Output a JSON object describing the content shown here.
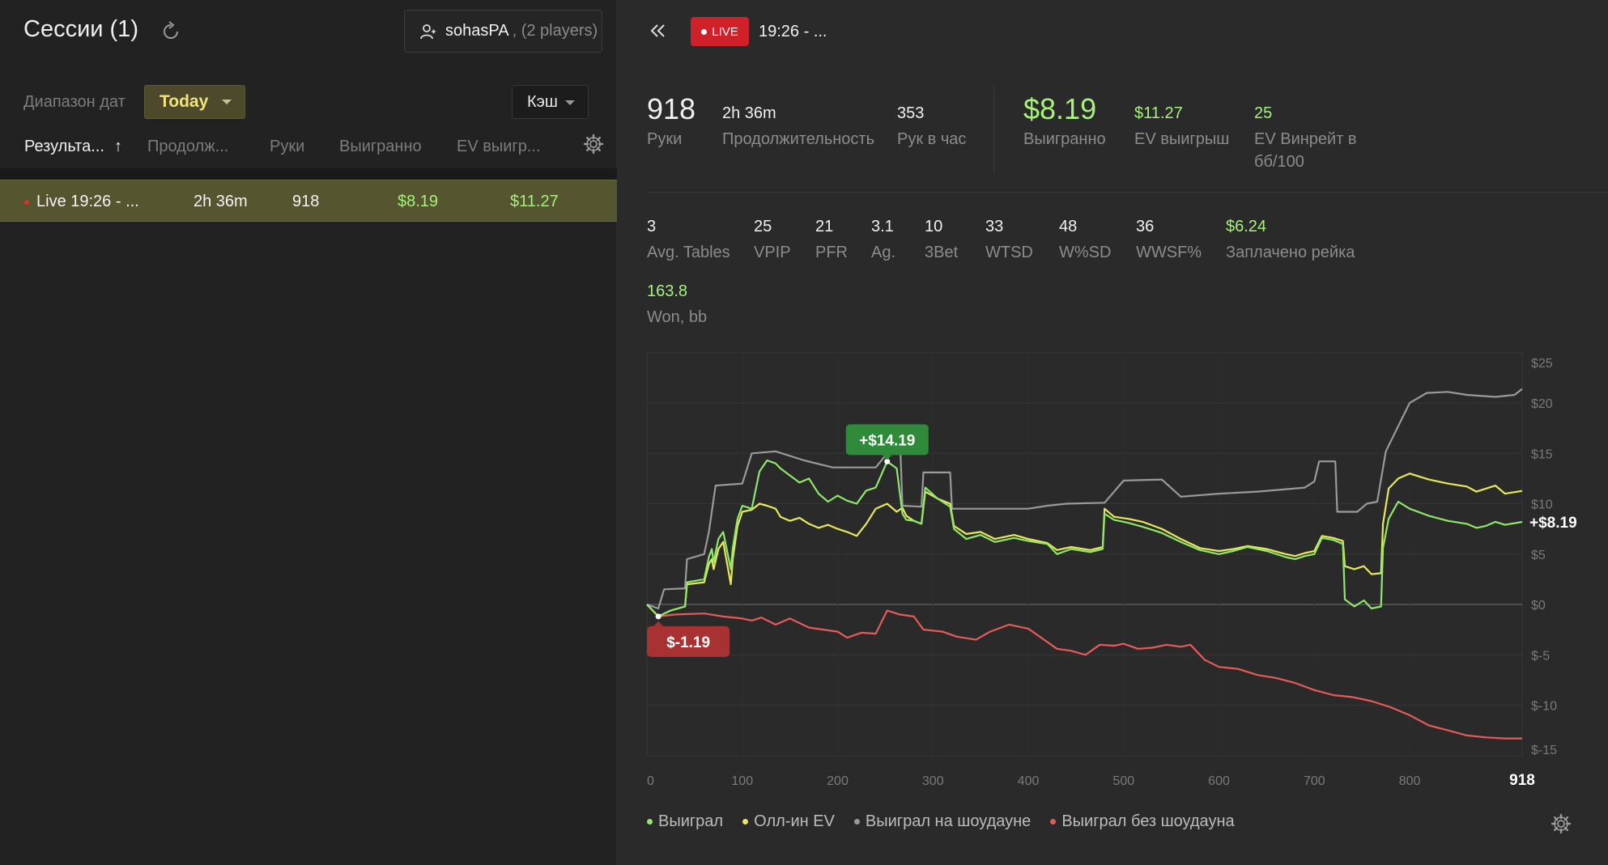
{
  "left": {
    "title": "Сессии (1)",
    "player": {
      "name": "sohasPA",
      "count": ", (2 players)"
    },
    "date_range_label": "Диапазон дат",
    "today_label": "Today",
    "cash_label": "Кэш",
    "columns": {
      "result": "Результа...",
      "sort_arrow": "↑",
      "duration": "Продолж...",
      "hands": "Руки",
      "won": "Выигранно",
      "ev": "EV выигр..."
    },
    "session_row": {
      "name": "Live 19:26 - ...",
      "duration": "2h 36m",
      "hands": "918",
      "won": "$8.19",
      "ev": "$11.27"
    }
  },
  "right": {
    "live_label": "LIVE",
    "session_time": "19:26 - ...",
    "stats_top": [
      {
        "value": "918",
        "label": "Руки"
      },
      {
        "value": "2h 36m",
        "label": "Продолжительность"
      },
      {
        "value": "353",
        "label": "Рук в час"
      },
      {
        "value": "$8.19",
        "label": "Выигранно"
      },
      {
        "value": "$11.27",
        "label": "EV выигрыш"
      },
      {
        "value": "25",
        "label": "EV Винрейт в",
        "label2": "бб/100"
      }
    ],
    "stats_mid": [
      {
        "value": "3",
        "label": "Avg. Tables"
      },
      {
        "value": "25",
        "label": "VPIP"
      },
      {
        "value": "21",
        "label": "PFR"
      },
      {
        "value": "3.1",
        "label": "Ag."
      },
      {
        "value": "10",
        "label": "3Bet"
      },
      {
        "value": "33",
        "label": "WTSD"
      },
      {
        "value": "48",
        "label": "W%SD"
      },
      {
        "value": "36",
        "label": "WWSF%"
      },
      {
        "value": "$6.24",
        "label": "Заплачено рейка"
      }
    ],
    "stats_bottom": {
      "value": "163.8",
      "label": "Won, bb"
    },
    "legend": [
      {
        "label": "Выиграл",
        "color": "#8ee86a"
      },
      {
        "label": "Олл-ин EV",
        "color": "#e8e85a"
      },
      {
        "label": "Выиграл на шоудауне",
        "color": "#9a9a9a"
      },
      {
        "label": "Выиграл без шоудауна",
        "color": "#e85a5a"
      }
    ]
  },
  "chart_data": {
    "type": "line",
    "x_ticks": [
      0,
      100,
      200,
      300,
      400,
      500,
      600,
      700,
      800
    ],
    "x_end_label": "918",
    "y_tick_labels": [
      "$25",
      "$20",
      "$15",
      "$10",
      "$5",
      "$0",
      "$-5",
      "$-10",
      "$-15"
    ],
    "y_ticks": [
      25,
      20,
      15,
      10,
      5,
      0,
      -5,
      -10,
      -15
    ],
    "xlim": [
      0,
      918
    ],
    "ylim": [
      -15,
      25
    ],
    "grid": true,
    "end_label": "+$8.19",
    "max_callout": {
      "label": "+$14.19",
      "x": 252,
      "y": 14.19
    },
    "min_callout": {
      "label": "$-1.19",
      "x": 12,
      "y": -1.19
    },
    "series": [
      {
        "name": "Выиграл",
        "color": "#8ee86a",
        "points": [
          [
            0,
            0
          ],
          [
            12,
            -1.19
          ],
          [
            25,
            -0.6
          ],
          [
            40,
            -0.2
          ],
          [
            42,
            2.2
          ],
          [
            60,
            2.5
          ],
          [
            65,
            4.7
          ],
          [
            68,
            5.5
          ],
          [
            70,
            4.2
          ],
          [
            75,
            6.5
          ],
          [
            80,
            7.2
          ],
          [
            88,
            3.5
          ],
          [
            90,
            5.6
          ],
          [
            95,
            8.5
          ],
          [
            100,
            9.8
          ],
          [
            110,
            9.5
          ],
          [
            118,
            13.2
          ],
          [
            126,
            14.3
          ],
          [
            135,
            14.0
          ],
          [
            140,
            13.5
          ],
          [
            150,
            12.8
          ],
          [
            160,
            12.1
          ],
          [
            170,
            12.5
          ],
          [
            180,
            11.0
          ],
          [
            190,
            10.2
          ],
          [
            200,
            10.8
          ],
          [
            210,
            10.3
          ],
          [
            220,
            10.0
          ],
          [
            230,
            11.3
          ],
          [
            240,
            11.6
          ],
          [
            252,
            14.19
          ],
          [
            262,
            13.5
          ],
          [
            268,
            9.0
          ],
          [
            272,
            8.4
          ],
          [
            280,
            8.3
          ],
          [
            288,
            8.0
          ],
          [
            292,
            11.6
          ],
          [
            305,
            10.5
          ],
          [
            318,
            9.7
          ],
          [
            322,
            7.5
          ],
          [
            335,
            6.5
          ],
          [
            350,
            6.9
          ],
          [
            365,
            6.2
          ],
          [
            385,
            6.6
          ],
          [
            400,
            6.3
          ],
          [
            420,
            6.0
          ],
          [
            430,
            5.0
          ],
          [
            445,
            5.5
          ],
          [
            465,
            5.2
          ],
          [
            478,
            5.5
          ],
          [
            480,
            9.0
          ],
          [
            490,
            8.4
          ],
          [
            505,
            8.1
          ],
          [
            520,
            7.7
          ],
          [
            540,
            7.1
          ],
          [
            560,
            6.2
          ],
          [
            580,
            5.4
          ],
          [
            600,
            5.0
          ],
          [
            615,
            5.3
          ],
          [
            630,
            5.7
          ],
          [
            650,
            5.3
          ],
          [
            670,
            4.7
          ],
          [
            680,
            4.5
          ],
          [
            690,
            4.8
          ],
          [
            700,
            5.0
          ],
          [
            708,
            6.6
          ],
          [
            720,
            6.4
          ],
          [
            730,
            6.0
          ],
          [
            732,
            0.5
          ],
          [
            742,
            -0.2
          ],
          [
            752,
            0.4
          ],
          [
            760,
            -0.4
          ],
          [
            770,
            -0.2
          ],
          [
            772,
            5.6
          ],
          [
            778,
            8.5
          ],
          [
            788,
            10.2
          ],
          [
            800,
            9.5
          ],
          [
            820,
            8.8
          ],
          [
            840,
            8.3
          ],
          [
            860,
            8.0
          ],
          [
            870,
            7.6
          ],
          [
            880,
            7.8
          ],
          [
            890,
            8.2
          ],
          [
            900,
            7.9
          ],
          [
            918,
            8.19
          ]
        ]
      },
      {
        "name": "Олл-ин EV",
        "color": "#e8e85a",
        "points": [
          [
            0,
            0
          ],
          [
            12,
            -1.19
          ],
          [
            25,
            -0.6
          ],
          [
            40,
            -0.2
          ],
          [
            42,
            2.0
          ],
          [
            60,
            2.2
          ],
          [
            65,
            4.0
          ],
          [
            68,
            4.5
          ],
          [
            70,
            3.5
          ],
          [
            75,
            5.5
          ],
          [
            80,
            6.2
          ],
          [
            88,
            2.0
          ],
          [
            90,
            4.5
          ],
          [
            95,
            7.8
          ],
          [
            100,
            9.2
          ],
          [
            110,
            9.4
          ],
          [
            118,
            10.0
          ],
          [
            126,
            9.8
          ],
          [
            135,
            9.5
          ],
          [
            140,
            8.7
          ],
          [
            150,
            8.3
          ],
          [
            160,
            8.6
          ],
          [
            170,
            8.0
          ],
          [
            180,
            7.6
          ],
          [
            190,
            7.9
          ],
          [
            200,
            7.5
          ],
          [
            210,
            7.2
          ],
          [
            220,
            6.8
          ],
          [
            230,
            8.0
          ],
          [
            240,
            9.5
          ],
          [
            252,
            10.0
          ],
          [
            262,
            9.2
          ],
          [
            268,
            9.6
          ],
          [
            272,
            8.8
          ],
          [
            280,
            8.3
          ],
          [
            288,
            8.0
          ],
          [
            292,
            11.2
          ],
          [
            305,
            10.5
          ],
          [
            318,
            10.0
          ],
          [
            322,
            7.8
          ],
          [
            335,
            7.0
          ],
          [
            350,
            7.2
          ],
          [
            365,
            6.5
          ],
          [
            385,
            6.9
          ],
          [
            400,
            6.5
          ],
          [
            420,
            6.1
          ],
          [
            430,
            5.4
          ],
          [
            445,
            5.7
          ],
          [
            465,
            5.4
          ],
          [
            478,
            5.7
          ],
          [
            480,
            9.5
          ],
          [
            490,
            8.7
          ],
          [
            505,
            8.5
          ],
          [
            520,
            8.2
          ],
          [
            540,
            7.5
          ],
          [
            560,
            6.5
          ],
          [
            580,
            5.6
          ],
          [
            600,
            5.3
          ],
          [
            615,
            5.5
          ],
          [
            630,
            5.8
          ],
          [
            650,
            5.5
          ],
          [
            670,
            5.0
          ],
          [
            680,
            4.8
          ],
          [
            690,
            5.1
          ],
          [
            700,
            5.3
          ],
          [
            708,
            6.8
          ],
          [
            720,
            6.6
          ],
          [
            730,
            6.3
          ],
          [
            732,
            3.8
          ],
          [
            742,
            3.5
          ],
          [
            752,
            3.8
          ],
          [
            760,
            3.0
          ],
          [
            770,
            3.1
          ],
          [
            772,
            8.0
          ],
          [
            778,
            11.5
          ],
          [
            788,
            12.5
          ],
          [
            800,
            13.0
          ],
          [
            820,
            12.4
          ],
          [
            840,
            12.0
          ],
          [
            860,
            11.7
          ],
          [
            870,
            11.2
          ],
          [
            880,
            11.5
          ],
          [
            890,
            11.8
          ],
          [
            900,
            11.0
          ],
          [
            918,
            11.27
          ]
        ]
      },
      {
        "name": "Выиграл на шоудауне",
        "color": "#9a9a9a",
        "points": [
          [
            0,
            0
          ],
          [
            12,
            -0.4
          ],
          [
            18,
            1.5
          ],
          [
            40,
            1.6
          ],
          [
            42,
            4.5
          ],
          [
            60,
            5.0
          ],
          [
            65,
            7.2
          ],
          [
            72,
            11.8
          ],
          [
            100,
            12.0
          ],
          [
            110,
            15.0
          ],
          [
            135,
            15.2
          ],
          [
            165,
            14.3
          ],
          [
            195,
            13.6
          ],
          [
            240,
            13.6
          ],
          [
            252,
            15.0
          ],
          [
            266,
            15.0
          ],
          [
            268,
            9.8
          ],
          [
            288,
            9.7
          ],
          [
            290,
            13.1
          ],
          [
            318,
            13.1
          ],
          [
            320,
            9.5
          ],
          [
            400,
            9.5
          ],
          [
            420,
            9.8
          ],
          [
            440,
            10.0
          ],
          [
            480,
            10.1
          ],
          [
            500,
            12.3
          ],
          [
            540,
            12.4
          ],
          [
            560,
            10.7
          ],
          [
            600,
            11.0
          ],
          [
            640,
            11.2
          ],
          [
            690,
            11.6
          ],
          [
            700,
            12.2
          ],
          [
            705,
            14.2
          ],
          [
            722,
            14.2
          ],
          [
            724,
            9.2
          ],
          [
            745,
            9.2
          ],
          [
            755,
            10.0
          ],
          [
            766,
            10.2
          ],
          [
            775,
            15.2
          ],
          [
            800,
            20.0
          ],
          [
            818,
            21.0
          ],
          [
            840,
            21.1
          ],
          [
            860,
            20.8
          ],
          [
            890,
            20.6
          ],
          [
            910,
            20.8
          ],
          [
            918,
            21.4
          ]
        ]
      },
      {
        "name": "Выиграл без шоудауна",
        "color": "#e85a5a",
        "points": [
          [
            0,
            0
          ],
          [
            12,
            -1.19
          ],
          [
            30,
            -1.0
          ],
          [
            60,
            -0.9
          ],
          [
            80,
            -1.2
          ],
          [
            100,
            -1.4
          ],
          [
            110,
            -1.6
          ],
          [
            120,
            -1.3
          ],
          [
            135,
            -2.0
          ],
          [
            150,
            -1.4
          ],
          [
            170,
            -2.3
          ],
          [
            185,
            -2.5
          ],
          [
            200,
            -2.7
          ],
          [
            210,
            -3.3
          ],
          [
            225,
            -2.8
          ],
          [
            240,
            -2.9
          ],
          [
            252,
            -0.6
          ],
          [
            265,
            -1.0
          ],
          [
            280,
            -1.2
          ],
          [
            290,
            -2.5
          ],
          [
            310,
            -2.7
          ],
          [
            325,
            -3.2
          ],
          [
            345,
            -3.5
          ],
          [
            360,
            -2.7
          ],
          [
            380,
            -2.0
          ],
          [
            400,
            -2.4
          ],
          [
            415,
            -3.4
          ],
          [
            430,
            -4.4
          ],
          [
            445,
            -4.6
          ],
          [
            460,
            -5.0
          ],
          [
            475,
            -4.0
          ],
          [
            490,
            -4.1
          ],
          [
            500,
            -3.9
          ],
          [
            515,
            -4.4
          ],
          [
            530,
            -4.3
          ],
          [
            545,
            -4.0
          ],
          [
            560,
            -4.2
          ],
          [
            570,
            -4.0
          ],
          [
            585,
            -5.5
          ],
          [
            600,
            -6.2
          ],
          [
            620,
            -6.4
          ],
          [
            640,
            -7.0
          ],
          [
            660,
            -7.3
          ],
          [
            680,
            -7.8
          ],
          [
            700,
            -8.5
          ],
          [
            720,
            -9.0
          ],
          [
            740,
            -9.2
          ],
          [
            760,
            -9.6
          ],
          [
            780,
            -10.2
          ],
          [
            800,
            -11.0
          ],
          [
            820,
            -12.0
          ],
          [
            840,
            -12.5
          ],
          [
            860,
            -13.0
          ],
          [
            880,
            -13.2
          ],
          [
            900,
            -13.3
          ],
          [
            918,
            -13.3
          ]
        ]
      }
    ]
  }
}
